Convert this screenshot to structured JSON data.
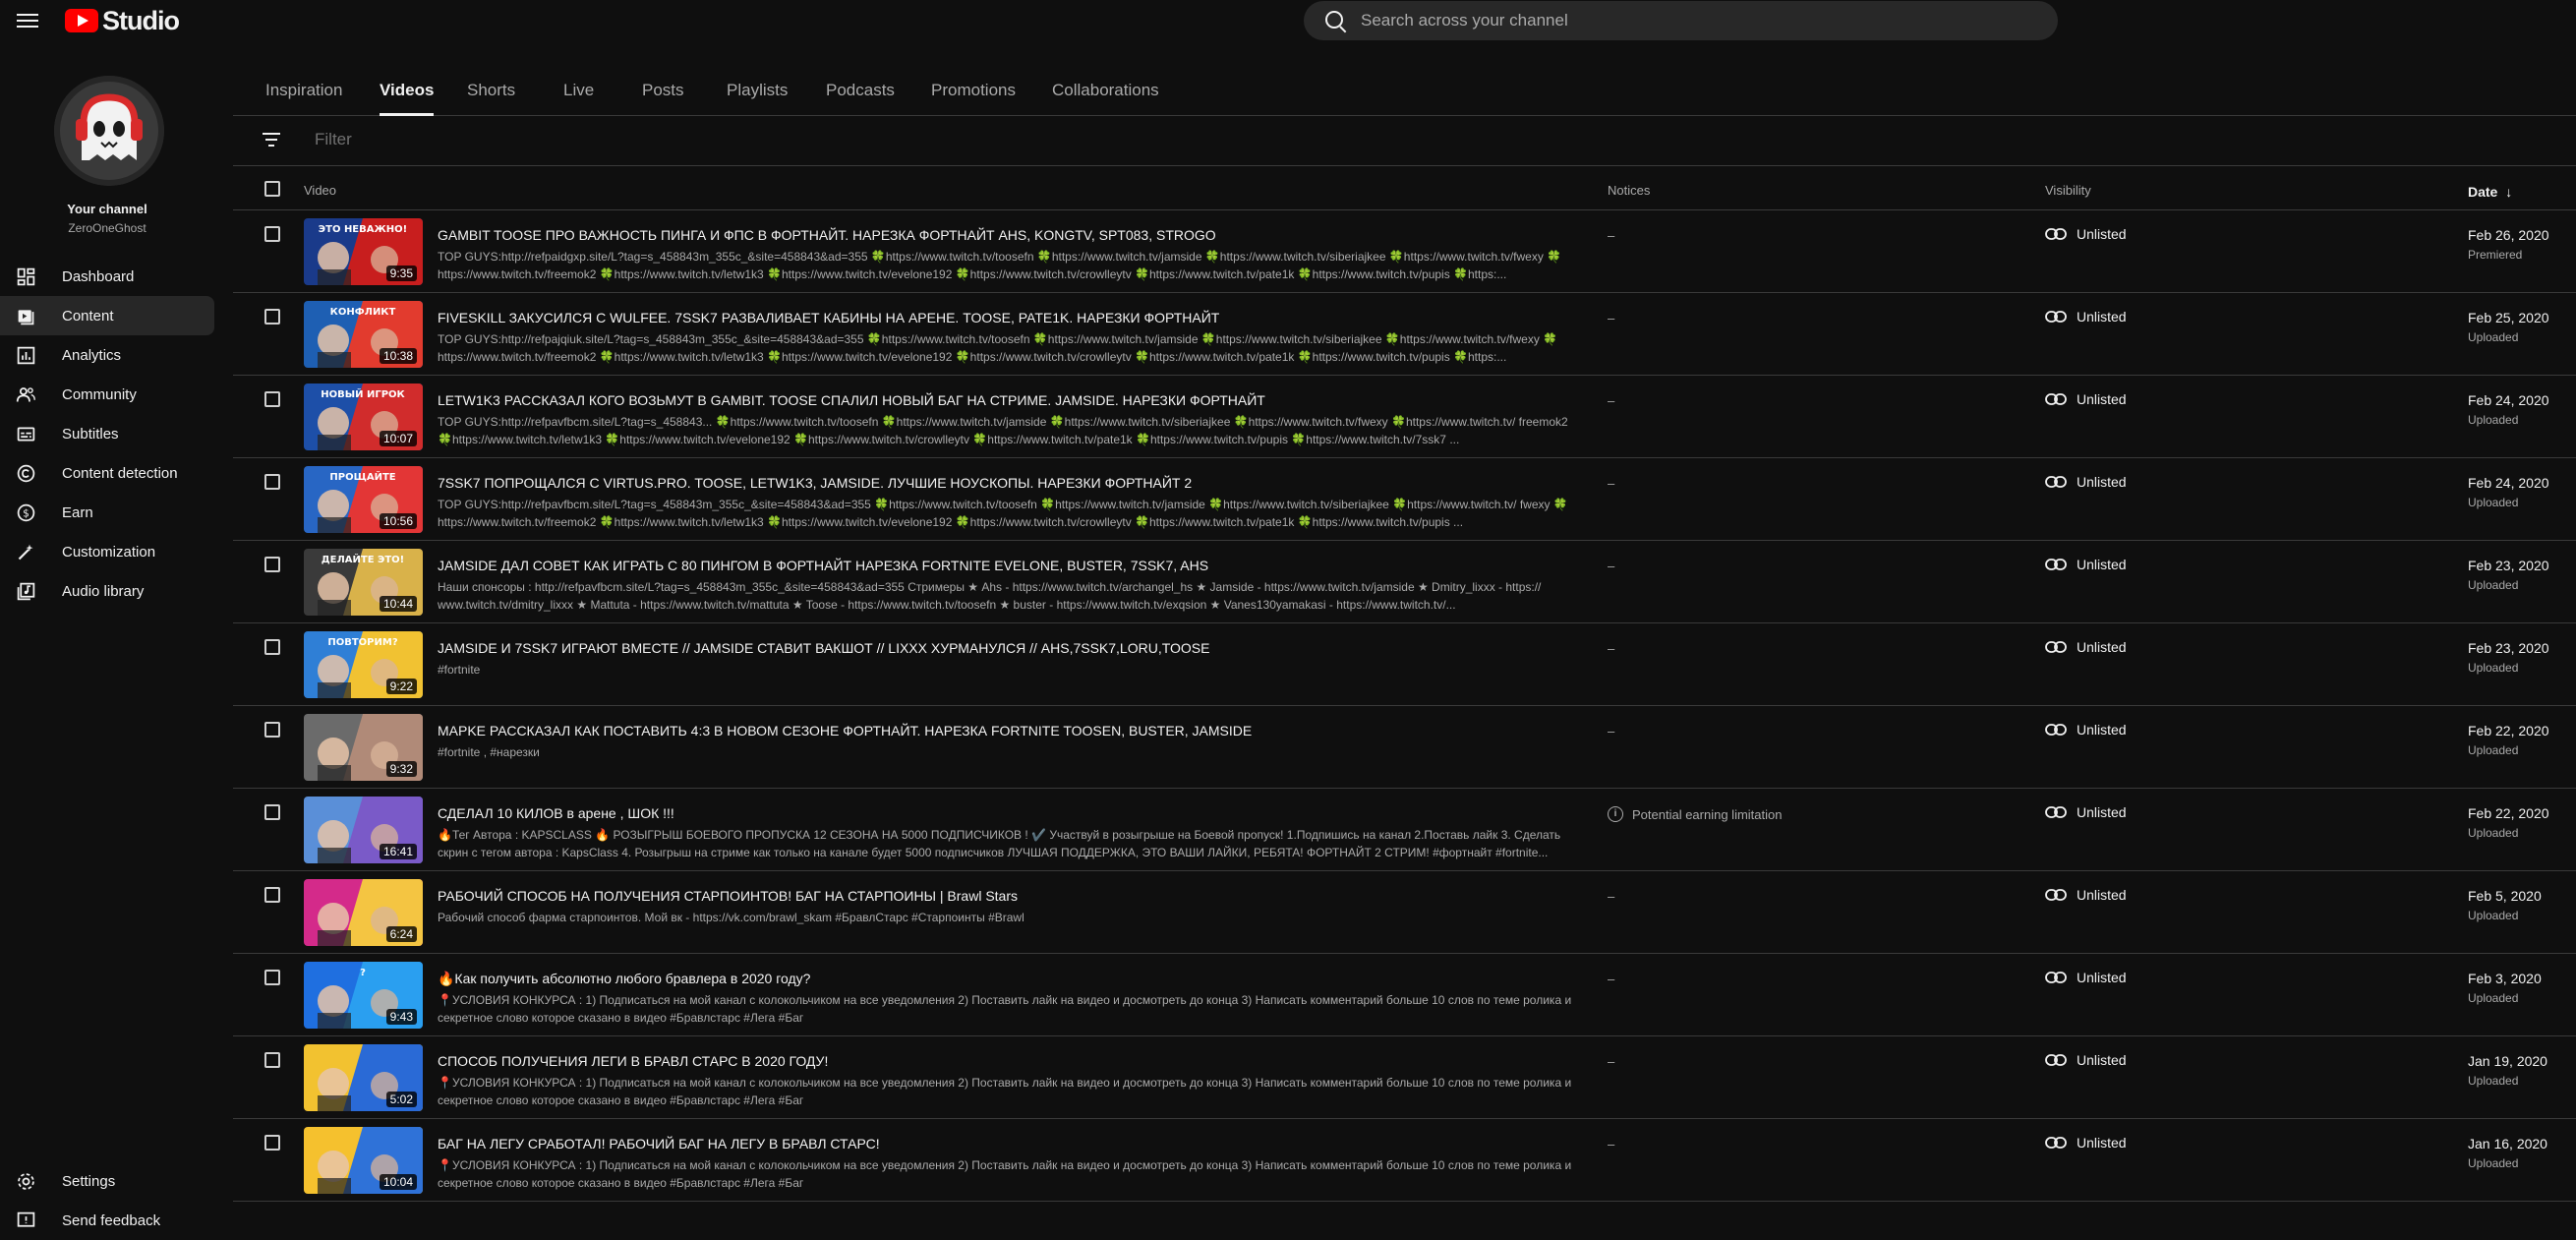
{
  "app": {
    "logo_text": "Studio",
    "brand_color": "#ff0000"
  },
  "search": {
    "placeholder": "Search across your channel"
  },
  "channel": {
    "title": "Your channel",
    "handle": "ZeroOneGhost"
  },
  "sidebar": {
    "items": [
      {
        "label": "Dashboard",
        "icon": "dashboard-icon"
      },
      {
        "label": "Content",
        "icon": "content-icon",
        "active": true
      },
      {
        "label": "Analytics",
        "icon": "analytics-icon"
      },
      {
        "label": "Community",
        "icon": "community-icon"
      },
      {
        "label": "Subtitles",
        "icon": "subtitles-icon"
      },
      {
        "label": "Content detection",
        "icon": "copyright-icon"
      },
      {
        "label": "Earn",
        "icon": "earn-icon"
      },
      {
        "label": "Customization",
        "icon": "customization-icon"
      },
      {
        "label": "Audio library",
        "icon": "audio-library-icon"
      }
    ],
    "bottom": [
      {
        "label": "Settings",
        "icon": "settings-icon"
      },
      {
        "label": "Send feedback",
        "icon": "feedback-icon"
      }
    ]
  },
  "tabs": [
    "Inspiration",
    "Videos",
    "Shorts",
    "Live",
    "Posts",
    "Playlists",
    "Podcasts",
    "Promotions",
    "Collaborations"
  ],
  "active_tab": "Videos",
  "filter": {
    "placeholder": "Filter"
  },
  "table": {
    "headers": {
      "video": "Video",
      "notices": "Notices",
      "visibility": "Visibility",
      "date": "Date",
      "date_sort": "↓"
    },
    "rows": [
      {
        "title": "GAMBIT TOOSE ПРО ВАЖНОСТЬ ПИНГА И ФПС В ФОРТНАЙТ. НАРЕЗКА ФОРТНАЙТ AHS, KONGTV, SPT083, STROGO",
        "desc": "TOP GUYS:http://refpaidgxp.site/L?tag=s_458843m_355c_&site=458843&ad=355 🍀https://www.twitch.tv/toosefn 🍀https://www.twitch.tv/jamside 🍀https://www.twitch.tv/siberiajkee 🍀https://www.twitch.tv/fwexy 🍀https://www.twitch.tv/freemok2 🍀https://www.twitch.tv/letw1k3 🍀https://www.twitch.tv/evelone192 🍀https://www.twitch.tv/crowlleytv 🍀https://www.twitch.tv/pate1k 🍀https://www.twitch.tv/pupis 🍀https:...",
        "duration": "9:35",
        "notice": "–",
        "visibility": "Unlisted",
        "date": "Feb 26, 2020",
        "status": "Premiered",
        "thumb_text": "ЭТО НЕВАЖНО!",
        "colors": [
          "#1a3a8a",
          "#c81e1e"
        ]
      },
      {
        "title": "FIVESKILL ЗАКУСИЛСЯ С WULFEE. 7SSK7 РАЗВАЛИВАЕТ КАБИНЫ НА АРЕНЕ. TOOSE, PATE1K. НАРЕЗКИ ФОРТНАЙТ",
        "desc": "TOP GUYS:http://refpajqiuk.site/L?tag=s_458843m_355c_&site=458843&ad=355 🍀https://www.twitch.tv/toosefn 🍀https://www.twitch.tv/jamside 🍀https://www.twitch.tv/siberiajkee 🍀https://www.twitch.tv/fwexy 🍀https://www.twitch.tv/freemok2 🍀https://www.twitch.tv/letw1k3 🍀https://www.twitch.tv/evelone192 🍀https://www.twitch.tv/crowlleytv 🍀https://www.twitch.tv/pate1k 🍀https://www.twitch.tv/pupis 🍀https:...",
        "duration": "10:38",
        "notice": "–",
        "visibility": "Unlisted",
        "date": "Feb 25, 2020",
        "status": "Uploaded",
        "thumb_text": "КОНФЛИКТ",
        "colors": [
          "#1e5fb3",
          "#e23b2e"
        ]
      },
      {
        "title": "LETW1K3 РАССКАЗАЛ КОГО ВОЗЬМУТ В GAMBIT. TOOSE СПАЛИЛ НОВЫЙ БАГ НА СТРИМЕ. JAMSIDE. НАРЕЗКИ ФОРТНАЙТ",
        "desc": "TOP GUYS:http://refpavfbcm.site/L?tag=s_458843... 🍀https://www.twitch.tv/toosefn 🍀https://www.twitch.tv/jamside 🍀https://www.twitch.tv/siberiajkee 🍀https://www.twitch.tv/fwexy 🍀https://www.twitch.tv/ freemok2 🍀https://www.twitch.tv/letw1k3 🍀https://www.twitch.tv/evelone192 🍀https://www.twitch.tv/crowlleytv 🍀https://www.twitch.tv/pate1k 🍀https://www.twitch.tv/pupis 🍀https://www.twitch.tv/7ssk7 ...",
        "duration": "10:07",
        "notice": "–",
        "visibility": "Unlisted",
        "date": "Feb 24, 2020",
        "status": "Uploaded",
        "thumb_text": "НОВЫЙ ИГРОК",
        "colors": [
          "#1d4fa8",
          "#d12c2c"
        ]
      },
      {
        "title": "7SSK7 ПОПРОЩАЛСЯ С VIRTUS.PRO. TOOSE, LETW1K3, JAMSIDE. ЛУЧШИЕ НОУСКОПЫ. НАРЕЗКИ ФОРТНАЙТ 2",
        "desc": "TOP GUYS:http://refpavfbcm.site/L?tag=s_458843m_355c_&site=458843&ad=355 🍀https://www.twitch.tv/toosefn 🍀https://www.twitch.tv/jamside 🍀https://www.twitch.tv/siberiajkee 🍀https://www.twitch.tv/ fwexy 🍀https://www.twitch.tv/freemok2 🍀https://www.twitch.tv/letw1k3 🍀https://www.twitch.tv/evelone192 🍀https://www.twitch.tv/crowlleytv 🍀https://www.twitch.tv/pate1k 🍀https://www.twitch.tv/pupis ...",
        "duration": "10:56",
        "notice": "–",
        "visibility": "Unlisted",
        "date": "Feb 24, 2020",
        "status": "Uploaded",
        "thumb_text": "ПРОЩАЙТЕ",
        "colors": [
          "#2866c4",
          "#e33636"
        ]
      },
      {
        "title": "JAMSIDE ДАЛ СОВЕТ КАК ИГРАТЬ С 80 ПИНГОМ В ФОРТНАЙТ НАРЕЗКА FORTNITE EVELONE, BUSTER, 7SSK7, AHS",
        "desc": "Наши спонсоры : http://refpavfbcm.site/L?tag=s_458843m_355c_&site=458843&ad=355 Стримеры ★ Ahs - https://www.twitch.tv/archangel_hs ★ Jamside - https://www.twitch.tv/jamside ★ Dmitry_lixxx - https:// www.twitch.tv/dmitry_lixxx ★ Mattuta - https://www.twitch.tv/mattuta ★ Toose - https://www.twitch.tv/toosefn ★ buster - https://www.twitch.tv/exqsion ★ Vanes130yamakasi - https://www.twitch.tv/...",
        "duration": "10:44",
        "notice": "–",
        "visibility": "Unlisted",
        "date": "Feb 23, 2020",
        "status": "Uploaded",
        "thumb_text": "ДЕЛАЙТЕ ЭТО!",
        "colors": [
          "#3a3a3a",
          "#d9b24a"
        ]
      },
      {
        "title": "JAMSIDE И 7SSK7 ИГРАЮТ ВМЕСТЕ // JAMSIDE СТАВИТ ВАКШОТ // LIXXX ХУРМАНУЛСЯ // AHS,7SSK7,LORU,TOOSE",
        "desc": "#fortnite",
        "duration": "9:22",
        "notice": "–",
        "visibility": "Unlisted",
        "date": "Feb 23, 2020",
        "status": "Uploaded",
        "thumb_text": "ПОВТОРИМ?",
        "colors": [
          "#2f7fd6",
          "#f1c232"
        ]
      },
      {
        "title": "MAPKE РАССКАЗАЛ КАК ПОСТАВИТЬ 4:3 В НОВОМ СЕЗОНЕ ФОРТНАЙТ. НАРЕЗКА FORTNITE TOOSEN, BUSTER, JAMSIDE",
        "desc": "#fortnite , #нарезки",
        "duration": "9:32",
        "notice": "–",
        "visibility": "Unlisted",
        "date": "Feb 22, 2020",
        "status": "Uploaded",
        "thumb_text": "",
        "colors": [
          "#6b6b6b",
          "#b08a78"
        ]
      },
      {
        "title": "СДЕЛАЛ 10 КИЛОВ в арене , ШОК !!!",
        "desc": "🔥Тег Автора : KAPSCLASS 🔥 РОЗЫГРЫШ БОЕВОГО ПРОПУСКА 12 СЕЗОНА НА 5000 ПОДПИСЧИКОВ ! ✔️ Участвуй в розыгрыше на Боевой пропуск! 1.Подпишись на канал 2.Поставь лайк 3. Сделать скрин с тегом автора : KapsClass 4. Розыгрыш на стриме как только на канале будет 5000 подписчиков ЛУЧШАЯ ПОДДЕРЖКА, ЭТО ВАШИ ЛАЙКИ, РЕБЯТА! ФОРТНАЙТ 2 СТРИМ! #фортнайт #fortnite...",
        "duration": "16:41",
        "notice": "Potential earning limitation",
        "notice_icon": true,
        "visibility": "Unlisted",
        "date": "Feb 22, 2020",
        "status": "Uploaded",
        "thumb_text": "",
        "colors": [
          "#5a8fd8",
          "#7a5ac8"
        ]
      },
      {
        "title": "РАБОЧИЙ СПОСОБ НА ПОЛУЧЕНИЯ СТАРПОИНТОВ! БАГ НА СТАРПОИНЫ | Brawl Stars",
        "desc": "Рабочий способ фарма старпоинтов. Мой вк - https://vk.com/brawl_skam #БравлСтарс #Старпоинты #Brawl",
        "duration": "6:24",
        "notice": "–",
        "visibility": "Unlisted",
        "date": "Feb 5, 2020",
        "status": "Uploaded",
        "thumb_text": "",
        "colors": [
          "#d42a8a",
          "#f4c542"
        ]
      },
      {
        "title": "🔥Как получить абсолютно любого бравлера в 2020 году?",
        "desc": "📍УСЛОВИЯ КОНКУРСА : 1) Подписаться на мой канал с колокольчиком на все уведомления 2) Поставить лайк на видео и досмотреть до конца 3) Написать комментарий больше 10 слов по теме ролика и секретное слово которое сказано в видео #Бравлстарс #Лега #Баг",
        "duration": "9:43",
        "notice": "–",
        "visibility": "Unlisted",
        "date": "Feb 3, 2020",
        "status": "Uploaded",
        "thumb_text": "?",
        "colors": [
          "#1f6fe0",
          "#2a9ff0"
        ]
      },
      {
        "title": "СПОСОБ ПОЛУЧЕНИЯ ЛЕГИ В БРАВЛ СТАРС В 2020 ГОДУ!",
        "desc": "📍УСЛОВИЯ КОНКУРСА : 1) Подписаться на мой канал с колокольчиком на все уведомления 2) Поставить лайк на видео и досмотреть до конца 3) Написать комментарий больше 10 слов по теме ролика и секретное слово которое сказано в видео #Бравлстарс #Лега #Баг",
        "duration": "5:02",
        "notice": "–",
        "visibility": "Unlisted",
        "date": "Jan 19, 2020",
        "status": "Uploaded",
        "thumb_text": "",
        "colors": [
          "#f2c230",
          "#2a6ad6"
        ]
      },
      {
        "title": "БАГ НА ЛЕГУ СРАБОТАЛ! РАБОЧИЙ БАГ НА ЛЕГУ В БРАВЛ СТАРС!",
        "desc": "📍УСЛОВИЯ КОНКУРСА : 1) Подписаться на мой канал с колокольчиком на все уведомления 2) Поставить лайк на видео и досмотреть до конца 3) Написать комментарий больше 10 слов по теме ролика и секретное слово которое сказано в видео #Бравлстарс #Лега #Баг",
        "duration": "10:04",
        "notice": "–",
        "visibility": "Unlisted",
        "date": "Jan 16, 2020",
        "status": "Uploaded",
        "thumb_text": "",
        "colors": [
          "#f5c12e",
          "#2f72d8"
        ]
      }
    ]
  }
}
